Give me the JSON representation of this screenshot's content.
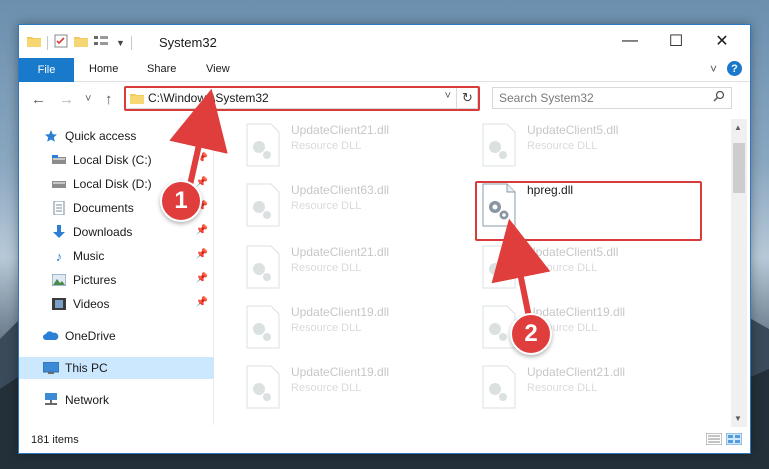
{
  "window": {
    "title": "System32",
    "minimize": "—",
    "maximize": "☐",
    "close": "✕"
  },
  "ribbon": {
    "file_tab": "File",
    "tabs": [
      "Home",
      "Share",
      "View"
    ],
    "expand": "˅",
    "help": "?"
  },
  "navigation": {
    "back": "←",
    "forward": "→",
    "recent": "˅",
    "up": "↑",
    "address": "C:\\Windows\\System32",
    "address_dropdown": "˅",
    "refresh": "↻",
    "search_placeholder": "Search System32"
  },
  "sidebar": {
    "items": [
      {
        "label": "Quick access",
        "icon": "star-icon",
        "pinned": false
      },
      {
        "label": "Local Disk (C:)",
        "icon": "drive-icon",
        "pinned": true
      },
      {
        "label": "Local Disk (D:)",
        "icon": "drive-icon",
        "pinned": true
      },
      {
        "label": "Documents",
        "icon": "documents-icon",
        "pinned": true
      },
      {
        "label": "Downloads",
        "icon": "download-icon",
        "pinned": true
      },
      {
        "label": "Music",
        "icon": "music-icon",
        "pinned": true
      },
      {
        "label": "Pictures",
        "icon": "pictures-icon",
        "pinned": true
      },
      {
        "label": "Videos",
        "icon": "videos-icon",
        "pinned": true
      },
      {
        "label": "OneDrive",
        "icon": "cloud-icon",
        "pinned": false
      },
      {
        "label": "This PC",
        "icon": "computer-icon",
        "pinned": false,
        "selected": true
      },
      {
        "label": "Network",
        "icon": "network-icon",
        "pinned": false
      }
    ]
  },
  "files": [
    {
      "name": "UpdateClient21.dll",
      "type": "Resource DLL"
    },
    {
      "name": "UpdateClient5.dll",
      "type": "Resource DLL"
    },
    {
      "name": "UpdateClient63.dll",
      "type": "Resource DLL"
    },
    {
      "name": "hpreg.dll",
      "type": "",
      "highlighted": true
    },
    {
      "name": "UpdateClient21.dll",
      "type": "Resource DLL"
    },
    {
      "name": "UpdateClient5.dll",
      "type": "Resource DLL"
    },
    {
      "name": "UpdateClient19.dll",
      "type": "Resource DLL"
    },
    {
      "name": "UpdateClient19.dll",
      "type": "Resource DLL"
    },
    {
      "name": "UpdateClient19.dll",
      "type": "Resource DLL"
    },
    {
      "name": "UpdateClient21.dll",
      "type": "Resource DLL"
    }
  ],
  "status": {
    "item_count": "181 items"
  },
  "callouts": {
    "step1": "1",
    "step2": "2"
  },
  "colors": {
    "accent": "#1979ca",
    "highlight": "#d93a3a",
    "selected_bg": "#cce8ff"
  }
}
